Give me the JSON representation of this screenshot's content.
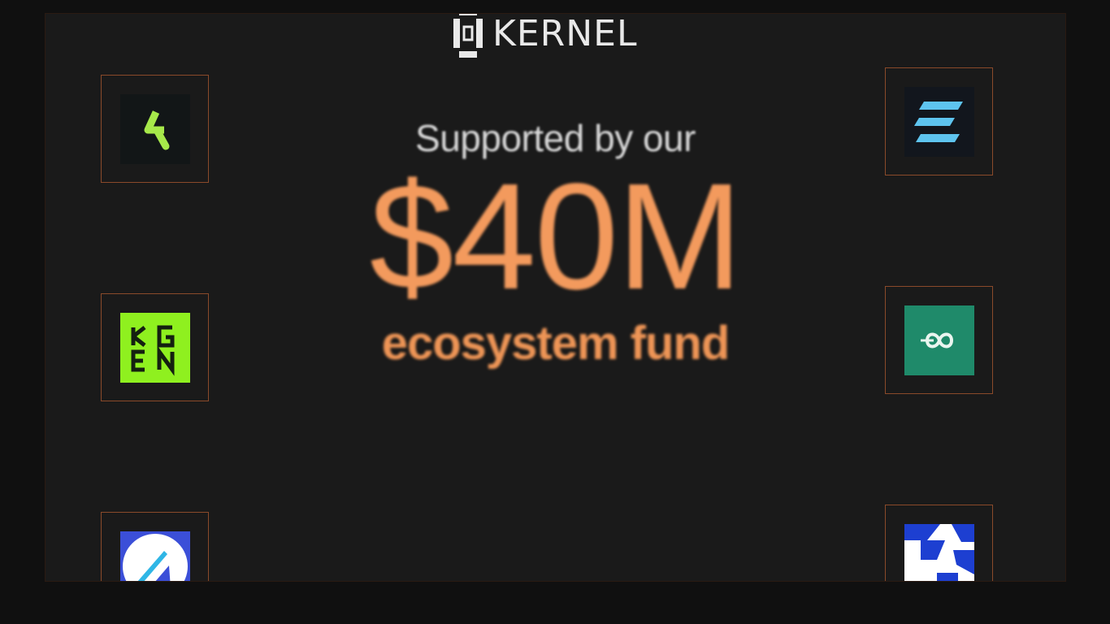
{
  "brand": {
    "name": "KERNEL",
    "icon": "kernel-logo-icon"
  },
  "hero": {
    "tagline": "Supported by our",
    "amount": "$40M",
    "subtitle": "ecosystem fund"
  },
  "colors": {
    "accent": "#f39a5d",
    "card_border": "#8a4a2a",
    "background": "#1a1a1a"
  },
  "partners": [
    {
      "icon": "lime-k-logo-icon",
      "side": "left"
    },
    {
      "icon": "kgen-logo-icon",
      "text": "KGEN",
      "side": "left"
    },
    {
      "icon": "blue-a-logo-icon",
      "side": "left"
    },
    {
      "icon": "blue-e-logo-icon",
      "side": "right"
    },
    {
      "icon": "infinity-eo-logo-icon",
      "text": "eo",
      "side": "right"
    },
    {
      "icon": "blue-geometric-logo-icon",
      "side": "right"
    }
  ]
}
